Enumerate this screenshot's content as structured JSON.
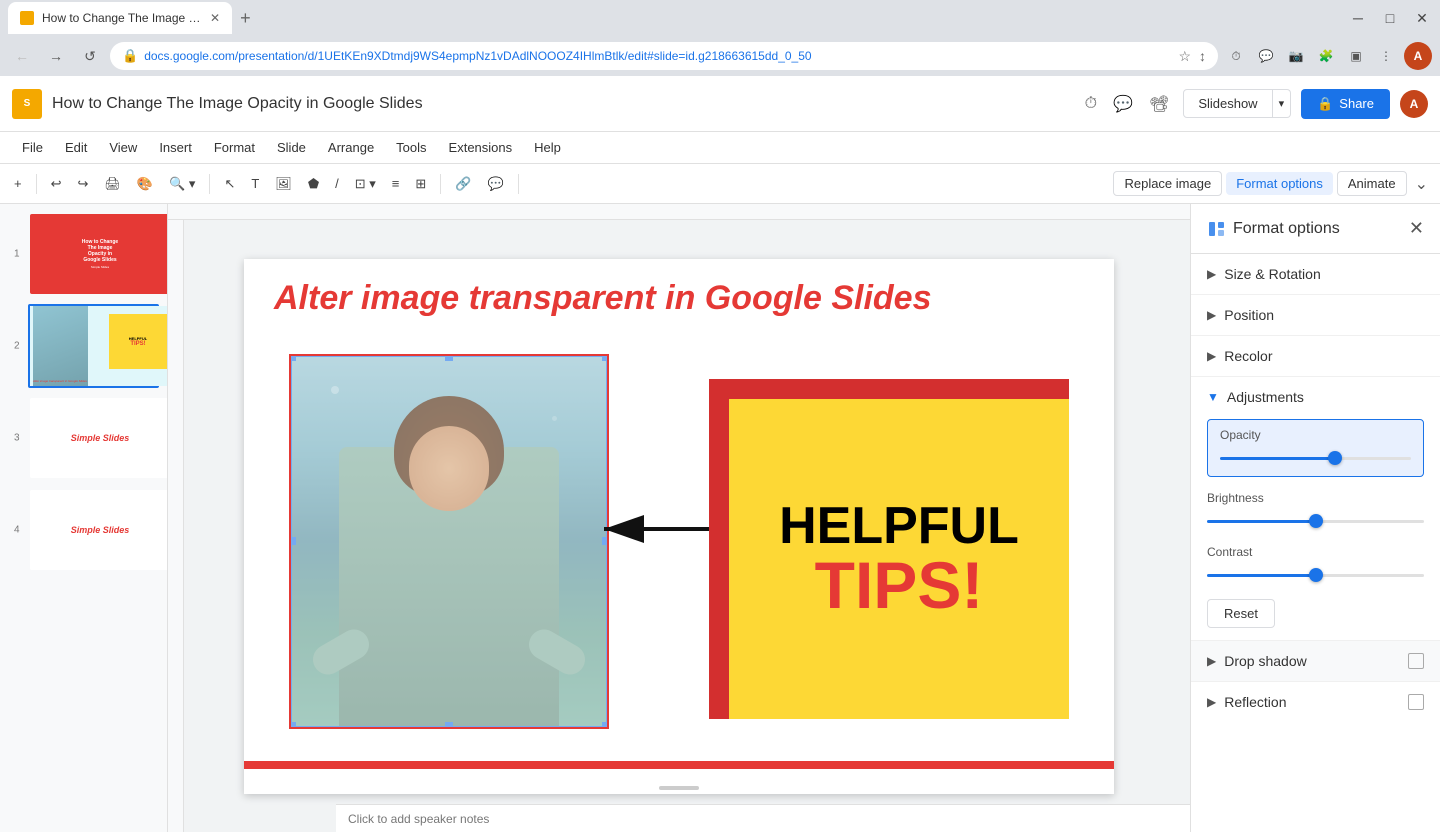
{
  "browser": {
    "tab_title": "How to Change The Image Opac...",
    "favicon_color": "#f4a800",
    "address": "docs.google.com/presentation/d/1UEtKEn9XDtmdj9WS4epmpNz1vDAdlNOOOZ4IHlmBtlk/edit#slide=id.g218663615dd_0_50",
    "new_tab_label": "+",
    "close_label": "✕",
    "back_label": "←",
    "forward_label": "→",
    "refresh_label": "↺",
    "window_minimize": "─",
    "window_maximize": "□",
    "window_close": "✕"
  },
  "app": {
    "logo_text": "S",
    "title": "How to Change The Image Opacity in Google Slides",
    "slideshow_label": "Slideshow",
    "slideshow_dropdown": "▾",
    "share_label": "Share",
    "share_lock": "🔒"
  },
  "menu": {
    "items": [
      "File",
      "Edit",
      "View",
      "Insert",
      "Format",
      "Slide",
      "Arrange",
      "Tools",
      "Extensions",
      "Help"
    ]
  },
  "toolbar": {
    "replace_image": "Replace image",
    "format_options": "Format options",
    "animate": "Animate",
    "collapse_label": "⌄"
  },
  "slide_panel": {
    "slides": [
      {
        "num": "1",
        "type": "red_title"
      },
      {
        "num": "2",
        "type": "content",
        "active": true
      },
      {
        "num": "3",
        "type": "simple"
      },
      {
        "num": "4",
        "type": "simple"
      }
    ]
  },
  "slide": {
    "heading": "Alter image transparent in Google Slides",
    "notes_placeholder": "Click to add speaker notes"
  },
  "format_panel": {
    "title": "Format options",
    "close_label": "✕",
    "sections": [
      {
        "label": "Size & Rotation",
        "expanded": false
      },
      {
        "label": "Position",
        "expanded": false
      },
      {
        "label": "Recolor",
        "expanded": false
      }
    ],
    "adjustments": {
      "label": "Adjustments",
      "expanded": true,
      "opacity_label": "Opacity",
      "opacity_value": 60,
      "brightness_label": "Brightness",
      "brightness_value": 50,
      "contrast_label": "Contrast",
      "contrast_value": 50,
      "reset_label": "Reset"
    },
    "drop_shadow": {
      "label": "Drop shadow",
      "checked": false
    },
    "reflection": {
      "label": "Reflection",
      "checked": false
    }
  },
  "helpful_card": {
    "helpful_text": "HELPFUL",
    "tips_text": "TIPS!"
  }
}
